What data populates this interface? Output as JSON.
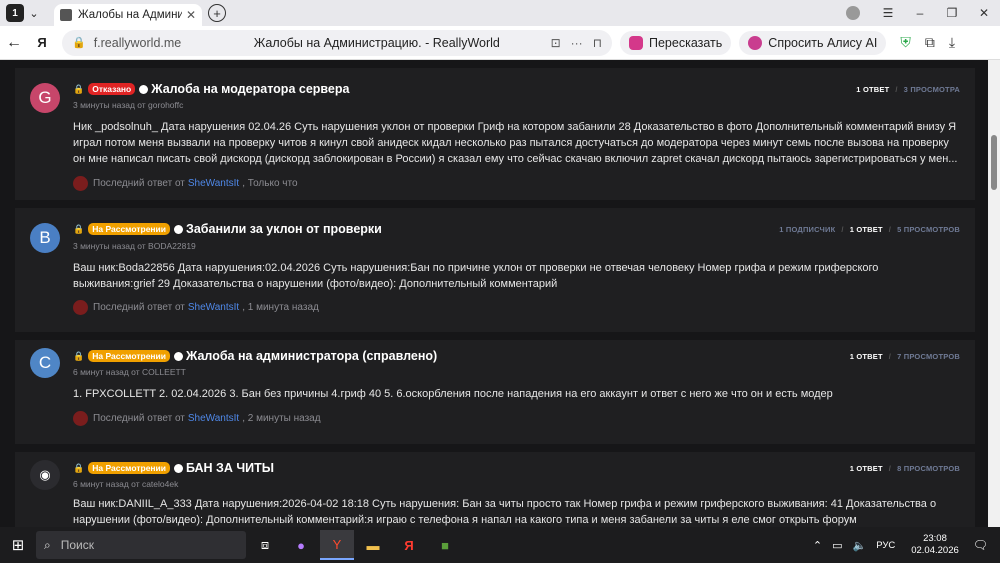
{
  "browser": {
    "tab_count": "1",
    "tab_title": "Жалобы на Администрацию.",
    "url_host": "f.reallyworld.me",
    "page_title": "Жалобы на Администрацию. - ReallyWorld",
    "translate_label": "Пересказать",
    "alice_label": "Спросить Алису AI"
  },
  "posts": [
    {
      "avatar_letter": "G",
      "avatar_color": "#c7466a",
      "badge": "Отказано",
      "badge_color": "#e02424",
      "title": "Жалоба на модератора сервера",
      "meta": "3 минуты назад от gorohoffc",
      "body": "Ник _podsolnuh_ Дата нарушения 02.04.26 Суть нарушения уклон от проверки Гриф на котором забанили 28 Доказательство в фото Дополнительный комментарий внизу Я играл потом меня вызвали на проверку читов я кинул свой анидеск кидал несколько раз пытался достучаться до модератора через минут семь после вызова на проверку он мне написал писать свой дискорд (дискорд заблокирован в России) я сказал ему что сейчас скачаю включил zapret скачал дискорд пытаюсь зарегистрироваться у мен...",
      "last_prefix": "Последний ответ от",
      "last_user": "SheWantsIt",
      "last_time": ", Только что",
      "subscribers": "",
      "replies": "1 ОТВЕТ",
      "views": "3 ПРОСМОТРА"
    },
    {
      "avatar_letter": "B",
      "avatar_color": "#4a7fc4",
      "badge": "На Рассмотрении",
      "badge_color": "#f0a000",
      "title": "Забанили за уклон от проверки",
      "meta": "3 минуты назад от BODA22819",
      "body": "Ваш ник:Boda22856 Дата нарушения:02.04.2026 Суть нарушения:Бан по причине уклон от проверки не отвечая человеку Номер грифа и режим гриферского выживания:grief 29 Доказательства о нарушении (фото/видео): Дополнительный комментарий",
      "last_prefix": "Последний ответ от",
      "last_user": "SheWantsIt",
      "last_time": ", 1 минута назад",
      "subscribers": "1 ПОДПИСЧИК",
      "replies": "1 ОТВЕТ",
      "views": "5 ПРОСМОТРОВ"
    },
    {
      "avatar_letter": "C",
      "avatar_color": "#4f86c6",
      "badge": "На Рассмотрении",
      "badge_color": "#f0a000",
      "title": "Жалоба на администратора (справлено)",
      "meta": "6 минут назад от COLLEETT",
      "body": "1. FPXCOLLETT 2. 02.04.2026 3. Бан без причины 4.гриф 40 5. 6.оскорбления после нападения на его аккаунт и ответ с него же что он и есть модер",
      "last_prefix": "Последний ответ от",
      "last_user": "SheWantsIt",
      "last_time": ", 2 минуты назад",
      "subscribers": "",
      "replies": "1 ОТВЕТ",
      "views": "7 ПРОСМОТРОВ"
    },
    {
      "avatar_letter": "",
      "avatar_color": "#2b2b2f",
      "badge": "На Рассмотрении",
      "badge_color": "#f0a000",
      "title": "БАН ЗА ЧИТЫ",
      "meta": "6 минут назад от catelo4ek",
      "body": "Ваш ник:DANIIL_A_333 Дата нарушения:2026-04-02 18:18 Суть нарушения: Бан за читы просто так Номер грифа и режим гриферского выживания: 41 Доказательства о нарушении (фото/видео): Дополнительный комментарий:я играю с телефона я напал на какого типа и меня забанели за читы я еле смог открыть форум",
      "last_prefix": "",
      "last_user": "",
      "last_time": "",
      "subscribers": "",
      "replies": "1 ОТВЕТ",
      "views": "8 ПРОСМОТРОВ"
    }
  ],
  "taskbar": {
    "search_placeholder": "Поиск",
    "lang": "РУС",
    "time": "23:08",
    "date": "02.04.2026"
  }
}
